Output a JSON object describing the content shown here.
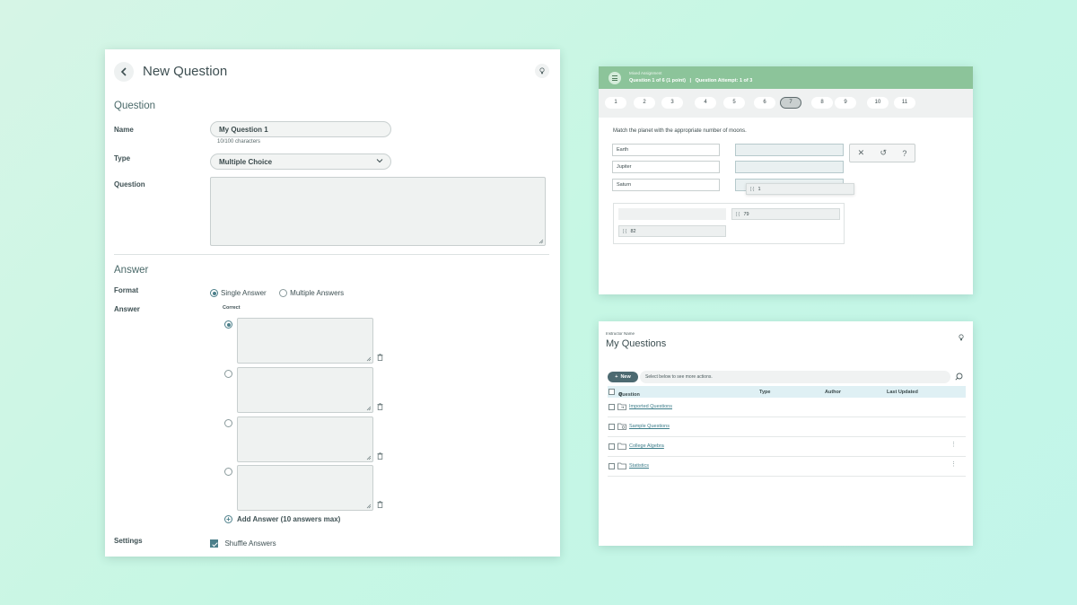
{
  "new_question": {
    "title": "New Question",
    "section_question": "Question",
    "name_label": "Name",
    "name_value": "My Question 1",
    "char_count": "10/100 characters",
    "type_label": "Type",
    "type_value": "Multiple Choice",
    "question_label": "Question",
    "section_answer": "Answer",
    "format_label": "Format",
    "format_options": [
      "Single Answer",
      "Multiple Answers"
    ],
    "format_selected": "Single Answer",
    "answer_label": "Answer",
    "correct_label": "Correct",
    "add_answer": "Add Answer (10 answers max)",
    "settings_label": "Settings",
    "shuffle_label": "Shuffle Answers"
  },
  "assignment": {
    "subtitle": "Mixed Assignment",
    "progress_line": "Question 1 of 6 (1 point)   |   Question Attempt: 1 of 3",
    "nav_numbers": [
      "1",
      "2",
      "3",
      "4",
      "5",
      "6",
      "7",
      "8",
      "9",
      "10",
      "11"
    ],
    "current_question": "7",
    "prompt": "Match the planet with the appropriate number of moons.",
    "planets": [
      "Earth",
      "Jupiter",
      "Saturn"
    ],
    "dragging_chip": "1",
    "bank_chips": [
      "79",
      "82"
    ]
  },
  "my_questions": {
    "instructor": "Instructor Name",
    "title": "My Questions",
    "new_button": "New",
    "actions_hint": "Select below to see more actions.",
    "columns": [
      "Question",
      "Type",
      "Author",
      "Last Updated"
    ],
    "rows": [
      "Imported Questions",
      "Sample Questions",
      "College Algebra",
      "Statistics"
    ]
  },
  "colors": {
    "header_green": "#8cc49a",
    "accent_teal": "#4c7f8a",
    "link_teal": "#3d7d8a"
  }
}
